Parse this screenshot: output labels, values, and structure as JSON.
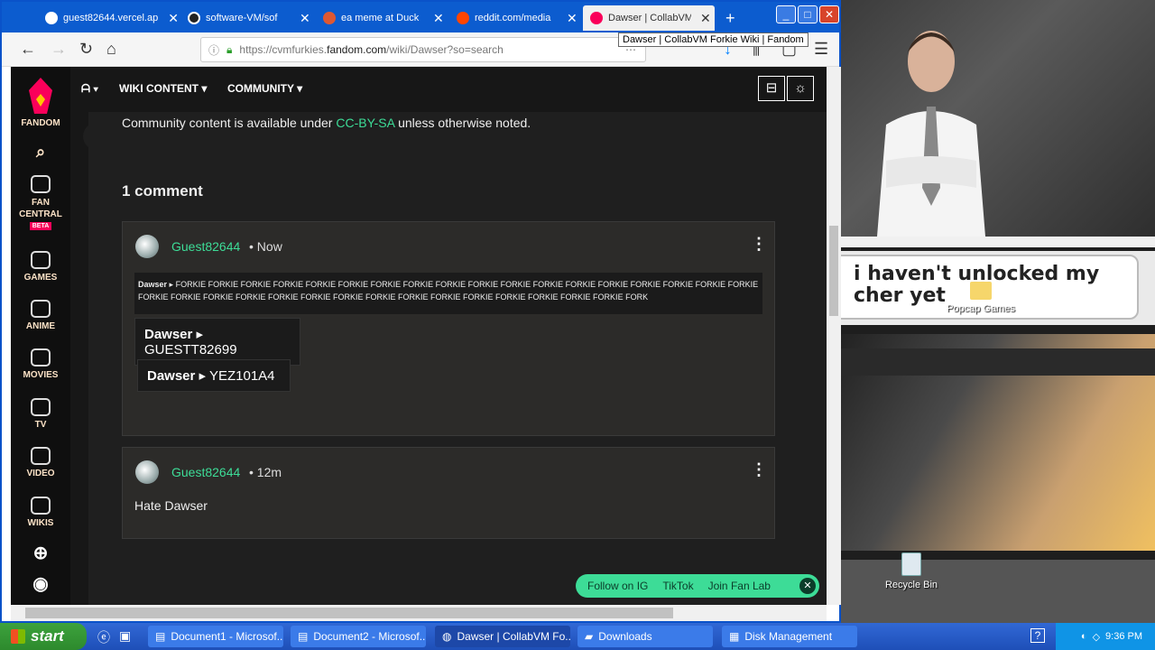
{
  "tabs": [
    {
      "title": "guest82644.vercel.ap",
      "icon": "globe-icon"
    },
    {
      "title": "software-VM/sof",
      "icon": "github-icon"
    },
    {
      "title": "ea meme at Duck",
      "icon": "duckduckgo-icon"
    },
    {
      "title": "reddit.com/media",
      "icon": "reddit-icon"
    },
    {
      "title": "Dawser | CollabVM",
      "icon": "fandom-icon",
      "active": true
    }
  ],
  "new_tab": "+",
  "tooltip": "Dawser | CollabVM Forkie Wiki | Fandom",
  "url": {
    "prefix": "https://cvmfurkies.",
    "host": "fandom.com",
    "path": "/wiki/Dawser?so=search"
  },
  "rail": {
    "logo": "FANDOM",
    "items": [
      {
        "label": "FAN CENTRAL",
        "badge": "BETA"
      },
      {
        "label": "GAMES"
      },
      {
        "label": "ANIME"
      },
      {
        "label": "MOVIES"
      },
      {
        "label": "TV"
      },
      {
        "label": "VIDEO"
      },
      {
        "label": "WIKIS"
      }
    ]
  },
  "topnav": {
    "wiki_content": "WIKI CONTENT",
    "community": "COMMUNITY"
  },
  "license": {
    "pre": "Community content is available under ",
    "link": "CC-BY-SA",
    "post": " unless otherwise noted."
  },
  "comments_heading": "1 comment",
  "comment1": {
    "user": "Guest82644",
    "time": "• Now",
    "quote_author": "Dawser",
    "quote_text": "▸ FORKIE FORKIE FORKIE FORKIE FORKIE FORKIE FORKIE FORKIE FORKIE FORKIE FORKIE FORKIE FORKIE FORKIE FORKIE FORKIE FORKIE FORKIE FORKIE FORKIE FORKIE FORKIE FORKIE FORKIE FORKIE FORKIE FORKIE FORKIE FORKIE FORKIE FORKIE FORKIE FORKIE FORK",
    "tag1_author": "Dawser",
    "tag1_text": "GUESTT82699",
    "tag2_author": "Dawser",
    "tag2_text": "YEZ101A4"
  },
  "comment2": {
    "user": "Guest82644",
    "time": "• 12m",
    "body": "Hate Dawser"
  },
  "fanlab": {
    "ig": "Follow on IG",
    "tiktok": "TikTok",
    "join": "Join Fan Lab"
  },
  "desktop": {
    "meme": "i haven't unlocked my\ncher yet",
    "popcap": "Popcap Games",
    "recycle": "Recycle Bin"
  },
  "taskbar": {
    "start": "start",
    "items": [
      "Document1 - Microsof...",
      "Document2 - Microsof...",
      "Dawser | CollabVM Fo...",
      "Downloads",
      "Disk Management"
    ],
    "clock": "9:36 PM"
  }
}
